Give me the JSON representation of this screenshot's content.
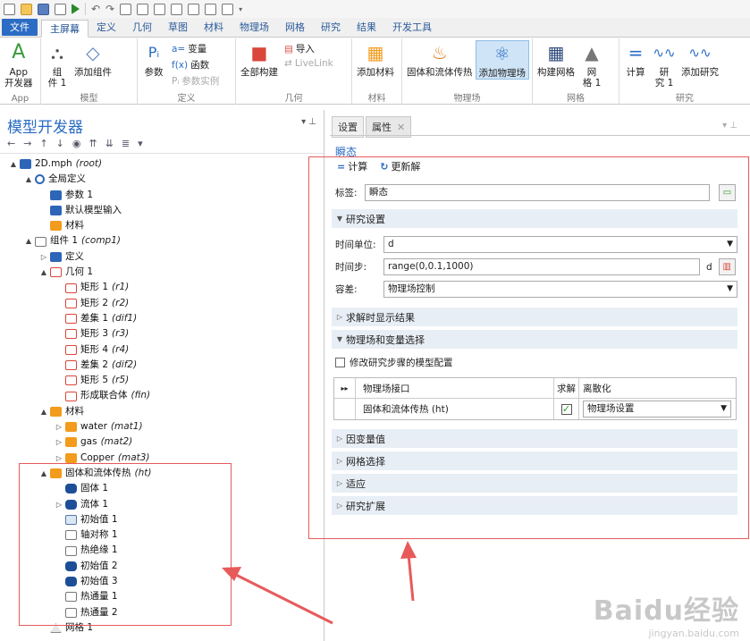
{
  "ribbon": {
    "tabs": [
      "文件",
      "主屏幕",
      "定义",
      "几何",
      "草图",
      "材料",
      "物理场",
      "网格",
      "研究",
      "结果",
      "开发工具"
    ],
    "active_tab": "主屏幕",
    "groups": {
      "app": {
        "name": "App",
        "btn": "App\n开发器"
      },
      "model": {
        "name": "模型",
        "component": "组\n件 1",
        "add_component": "添加组件"
      },
      "define": {
        "name": "定义",
        "params": "参数",
        "vars": "变量",
        "funcs": "函数",
        "param_case": "参数实例"
      },
      "geometry": {
        "name": "几何",
        "build_all": "全部构建",
        "import": "导入",
        "livelink": "LiveLink"
      },
      "material": {
        "name": "材料",
        "add_material": "添加材料"
      },
      "physics": {
        "name": "物理场",
        "ht": "固体和流体传热",
        "add_physics": "添加物理场"
      },
      "mesh": {
        "name": "网格",
        "build_mesh": "构建网格",
        "mesh1": "网\n格 1"
      },
      "study": {
        "name": "研究",
        "compute": "计算",
        "study1": "研\n究 1",
        "add_study": "添加研究"
      }
    }
  },
  "model_builder": {
    "title": "模型开发器",
    "tree": [
      {
        "level": 0,
        "exp": "▲",
        "icon": "i-blue",
        "label": "2D.mph",
        "tag": "(root)"
      },
      {
        "level": 1,
        "exp": "▲",
        "icon": "i-globe",
        "label": "全局定义",
        "tag": ""
      },
      {
        "level": 2,
        "exp": "",
        "icon": "i-blue",
        "label": "参数 1",
        "tag": ""
      },
      {
        "level": 2,
        "exp": "",
        "icon": "i-blue",
        "label": "默认模型输入",
        "tag": ""
      },
      {
        "level": 2,
        "exp": "",
        "icon": "i-orange",
        "label": "材料",
        "tag": ""
      },
      {
        "level": 1,
        "exp": "▲",
        "icon": "i-gray",
        "label": "组件 1",
        "tag": "(comp1)"
      },
      {
        "level": 2,
        "exp": "▷",
        "icon": "i-blue",
        "label": "定义",
        "tag": ""
      },
      {
        "level": 2,
        "exp": "▲",
        "icon": "i-red",
        "label": "几何 1",
        "tag": ""
      },
      {
        "level": 3,
        "exp": "",
        "icon": "i-red",
        "label": "矩形 1",
        "tag": "(r1)"
      },
      {
        "level": 3,
        "exp": "",
        "icon": "i-red",
        "label": "矩形 2",
        "tag": "(r2)"
      },
      {
        "level": 3,
        "exp": "",
        "icon": "i-red",
        "label": "差集 1",
        "tag": "(dif1)"
      },
      {
        "level": 3,
        "exp": "",
        "icon": "i-red",
        "label": "矩形 3",
        "tag": "(r3)"
      },
      {
        "level": 3,
        "exp": "",
        "icon": "i-red",
        "label": "矩形 4",
        "tag": "(r4)"
      },
      {
        "level": 3,
        "exp": "",
        "icon": "i-red",
        "label": "差集 2",
        "tag": "(dif2)"
      },
      {
        "level": 3,
        "exp": "",
        "icon": "i-red",
        "label": "矩形 5",
        "tag": "(r5)"
      },
      {
        "level": 3,
        "exp": "",
        "icon": "i-red",
        "label": "形成联合体",
        "tag": "(fin)"
      },
      {
        "level": 2,
        "exp": "▲",
        "icon": "i-orange",
        "label": "材料",
        "tag": ""
      },
      {
        "level": 3,
        "exp": "▷",
        "icon": "i-orange",
        "label": "water",
        "tag": "(mat1)"
      },
      {
        "level": 3,
        "exp": "▷",
        "icon": "i-orange",
        "label": "gas",
        "tag": "(mat2)"
      },
      {
        "level": 3,
        "exp": "▷",
        "icon": "i-orange",
        "label": "Copper",
        "tag": "(mat3)"
      },
      {
        "level": 2,
        "exp": "▲",
        "icon": "i-orange",
        "label": "固体和流体传热",
        "tag": "(ht)"
      },
      {
        "level": 3,
        "exp": "",
        "icon": "i-dark",
        "label": "固体 1",
        "tag": ""
      },
      {
        "level": 3,
        "exp": "▷",
        "icon": "i-dark",
        "label": "流体 1",
        "tag": ""
      },
      {
        "level": 3,
        "exp": "",
        "icon": "i-ltblue",
        "label": "初始值 1",
        "tag": ""
      },
      {
        "level": 3,
        "exp": "",
        "icon": "i-gray",
        "label": "轴对称 1",
        "tag": ""
      },
      {
        "level": 3,
        "exp": "",
        "icon": "i-gray",
        "label": "热绝缘 1",
        "tag": ""
      },
      {
        "level": 3,
        "exp": "",
        "icon": "i-dark",
        "label": "初始值 2",
        "tag": ""
      },
      {
        "level": 3,
        "exp": "",
        "icon": "i-dark",
        "label": "初始值 3",
        "tag": ""
      },
      {
        "level": 3,
        "exp": "",
        "icon": "i-gray",
        "label": "热通量 1",
        "tag": ""
      },
      {
        "level": 3,
        "exp": "",
        "icon": "i-gray",
        "label": "热通量 2",
        "tag": ""
      },
      {
        "level": 2,
        "exp": "",
        "icon": "i-grid",
        "label": "网格 1",
        "tag": ""
      }
    ]
  },
  "settings": {
    "tabs": [
      "设置",
      "属性"
    ],
    "node_title": "瞬态",
    "compute": "计算",
    "update": "更新解",
    "label_field": {
      "label": "标签:",
      "value": "瞬态"
    },
    "sections": {
      "study_settings": "研究设置",
      "results_while": "求解时显示结果",
      "physics_select": "物理场和变量选择",
      "dep_vars": "因变量值",
      "mesh_select": "网格选择",
      "adaptation": "适应",
      "extension": "研究扩展"
    },
    "time_unit": {
      "label": "时间单位:",
      "value": "d"
    },
    "times": {
      "label": "时间步:",
      "value": "range(0,0.1,1000)",
      "unit": "d"
    },
    "tolerance": {
      "label": "容差:",
      "value": "物理场控制"
    },
    "modify_config": "修改研究步骤的模型配置",
    "table": {
      "headers": [
        "物理场接口",
        "求解",
        "离散化"
      ],
      "rows": [
        {
          "iface": "固体和流体传热 (ht)",
          "solve": true,
          "disc": "物理场设置"
        }
      ]
    }
  },
  "watermark": {
    "line1": "Baidu经验",
    "line2": "jingyan.baidu.com"
  },
  "colors": {
    "accent": "#2b6cc4",
    "annotation": "#e85a5a",
    "active_btn": "#cfe4f7"
  }
}
